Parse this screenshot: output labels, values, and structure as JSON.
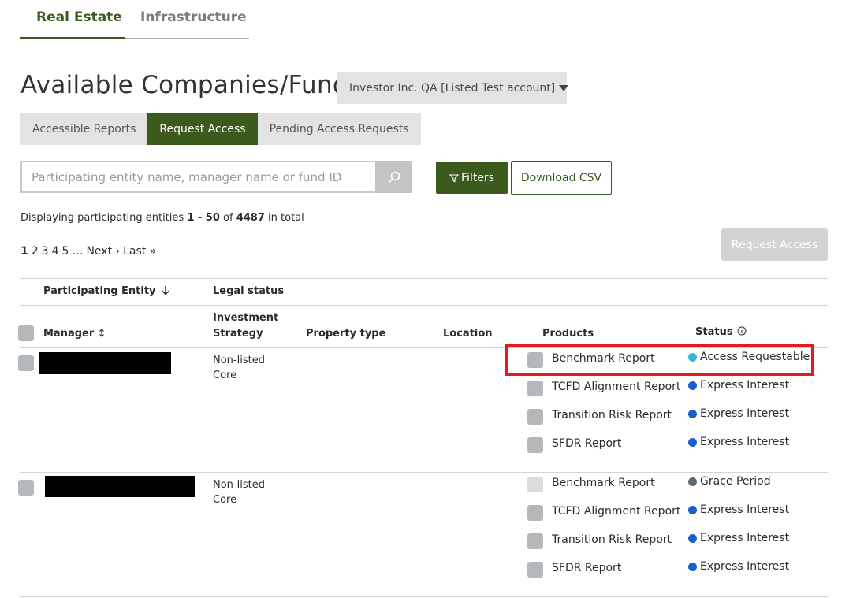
{
  "top_tabs": [
    {
      "label": "Real Estate",
      "active": true
    },
    {
      "label": "Infrastructure",
      "active": false
    }
  ],
  "page_title": "Available Companies/Funds",
  "account_select": {
    "value": "Investor Inc. QA [Listed Test account]"
  },
  "sub_tabs": [
    {
      "label": "Accessible Reports",
      "active": false
    },
    {
      "label": "Request Access",
      "active": true
    },
    {
      "label": "Pending Access Requests",
      "active": false
    }
  ],
  "search": {
    "placeholder": "Participating entity name, manager name or fund ID",
    "icon": "search-icon"
  },
  "filters_label": "Filters",
  "download_csv_label": "Download CSV",
  "display_info": {
    "prefix": "Displaying participating entities",
    "range": "1 - 50",
    "of": "of",
    "total": "4487",
    "suffix": "in total"
  },
  "pagination": {
    "pages": [
      "1",
      "2",
      "3",
      "4",
      "5"
    ],
    "ellipsis": "…",
    "next": "Next ›",
    "last": "Last »"
  },
  "request_access_label": "Request Access",
  "table": {
    "headers": {
      "participating_entity": "Participating Entity",
      "legal_status": "Legal status",
      "manager": "Manager",
      "investment_strategy_1": "Investment",
      "investment_strategy_2": "Strategy",
      "property_type": "Property type",
      "location": "Location",
      "products": "Products",
      "status": "Status"
    },
    "rows": [
      {
        "legal_status": "Non-listed",
        "strategy": "Core",
        "products": [
          {
            "name": "Benchmark Report",
            "status": "Access Requestable",
            "status_color": "#3cb4d3",
            "checkbox_disabled": false
          },
          {
            "name": "TCFD Alignment Report",
            "status": "Express Interest",
            "status_color": "#1a5fcf",
            "checkbox_disabled": false
          },
          {
            "name": "Transition Risk Report",
            "status": "Express Interest",
            "status_color": "#1a5fcf",
            "checkbox_disabled": false
          },
          {
            "name": "SFDR Report",
            "status": "Express Interest",
            "status_color": "#1a5fcf",
            "checkbox_disabled": false
          }
        ]
      },
      {
        "legal_status": "Non-listed",
        "strategy": "Core",
        "products": [
          {
            "name": "Benchmark Report",
            "status": "Grace Period",
            "status_color": "#5f6a72",
            "checkbox_disabled": true
          },
          {
            "name": "TCFD Alignment Report",
            "status": "Express Interest",
            "status_color": "#1a5fcf",
            "checkbox_disabled": false
          },
          {
            "name": "Transition Risk Report",
            "status": "Express Interest",
            "status_color": "#1a5fcf",
            "checkbox_disabled": false
          },
          {
            "name": "SFDR Report",
            "status": "Express Interest",
            "status_color": "#1a5fcf",
            "checkbox_disabled": false
          }
        ]
      }
    ]
  },
  "colors": {
    "brand_green": "#3d5a1e",
    "highlight_red": "#e8191c"
  }
}
